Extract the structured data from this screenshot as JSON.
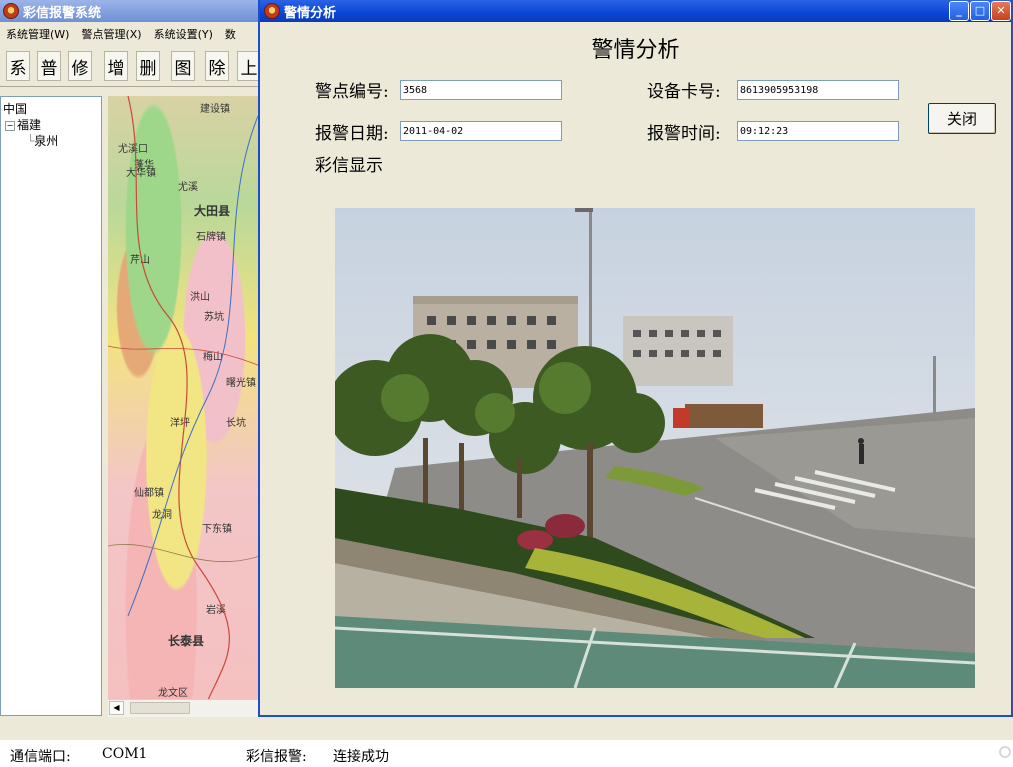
{
  "main_window": {
    "title": "彩信报警系统",
    "menu": [
      "系统管理(W)",
      "警点管理(X)",
      "系统设置(Y)",
      "数"
    ],
    "toolbar_buttons": [
      "系",
      "普",
      "修",
      "增",
      "删",
      "图",
      "除",
      "上"
    ],
    "tree": {
      "root": "中国",
      "province": "福建",
      "city": "泉州"
    },
    "map_labels": [
      "建设镇",
      "大田县",
      "尤溪口",
      "芹山",
      "曙光镇",
      "梅山",
      "洋坪",
      "长坑",
      "仙都镇",
      "龙洞",
      "长泰县",
      "蓬华",
      "岩溪",
      "大华镇",
      "下东镇",
      "石牌镇",
      "洪山",
      "尤溪",
      "龙文区",
      "苏坑"
    ]
  },
  "dialog": {
    "title": "警情分析",
    "heading": "警情分析",
    "fields": {
      "alarm_point_id": {
        "label": "警点编号:",
        "value": "3568"
      },
      "device_card_no": {
        "label": "设备卡号:",
        "value": "8613905953198"
      },
      "alarm_date": {
        "label": "报警日期:",
        "value": "2011-04-02"
      },
      "alarm_time": {
        "label": "报警时间:",
        "value": "09:12:23"
      }
    },
    "close_label": "关闭",
    "mms_display_label": "彩信显示"
  },
  "statusbar": {
    "port_label": "通信端口:",
    "port_value": "COM1",
    "mms_status_label": "彩信报警:",
    "mms_status_value": "连接成功"
  }
}
